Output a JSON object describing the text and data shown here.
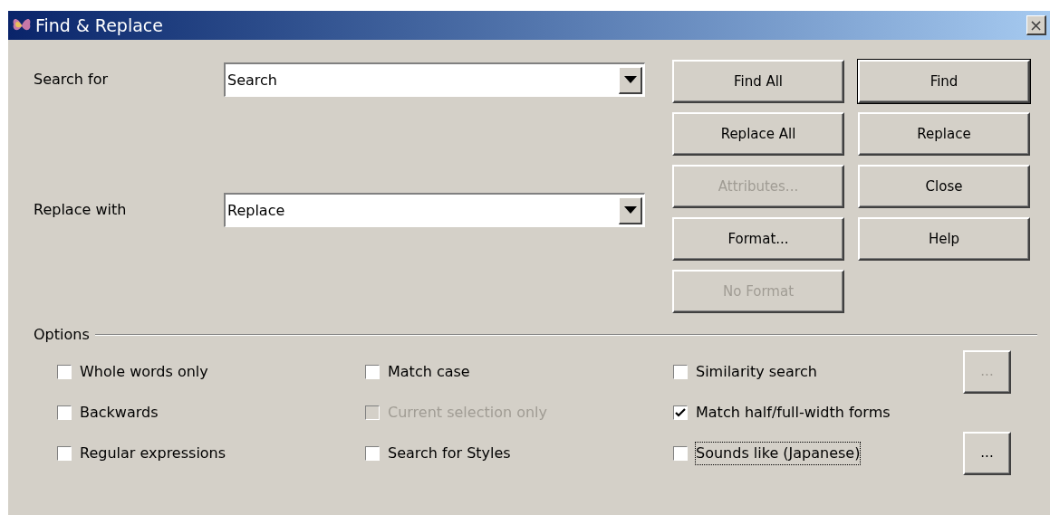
{
  "window": {
    "title": "Find & Replace",
    "close": "×"
  },
  "search_for": {
    "label": "Search for",
    "value": "Search"
  },
  "replace_with": {
    "label": "Replace with",
    "value": "Replace"
  },
  "buttons": [
    {
      "label": "Find All",
      "disabled": false,
      "default": false
    },
    {
      "label": "Find",
      "disabled": false,
      "default": true
    },
    {
      "label": "Replace All",
      "disabled": false,
      "default": false
    },
    {
      "label": "Replace",
      "disabled": false,
      "default": false
    },
    {
      "label": "Attributes...",
      "disabled": true,
      "default": false
    },
    {
      "label": "Close",
      "disabled": false,
      "default": false
    },
    {
      "label": "Format...",
      "disabled": false,
      "default": false
    },
    {
      "label": "Help",
      "disabled": false,
      "default": false
    },
    {
      "label": "No Format",
      "disabled": true,
      "default": false
    }
  ],
  "options": {
    "title": "Options",
    "rows": [
      {
        "items": [
          {
            "label": "Whole words only",
            "checked": false,
            "disabled": false,
            "focused": false
          },
          {
            "label": "Match case",
            "checked": false,
            "disabled": false,
            "focused": false
          },
          {
            "label": "Similarity search",
            "checked": false,
            "disabled": false,
            "focused": false
          }
        ],
        "button": {
          "label": "...",
          "disabled": true
        }
      },
      {
        "items": [
          {
            "label": "Backwards",
            "checked": false,
            "disabled": false,
            "focused": false
          },
          {
            "label": "Current selection only",
            "checked": false,
            "disabled": true,
            "focused": false
          },
          {
            "label": "Match half/full-width forms",
            "checked": true,
            "disabled": false,
            "focused": false
          }
        ]
      },
      {
        "items": [
          {
            "label": "Regular expressions",
            "checked": false,
            "disabled": false,
            "focused": false
          },
          {
            "label": "Search for Styles",
            "checked": false,
            "disabled": false,
            "focused": false
          },
          {
            "label": "Sounds like (Japanese)",
            "checked": false,
            "disabled": false,
            "focused": true
          }
        ],
        "button": {
          "label": "...",
          "disabled": false
        }
      }
    ]
  }
}
